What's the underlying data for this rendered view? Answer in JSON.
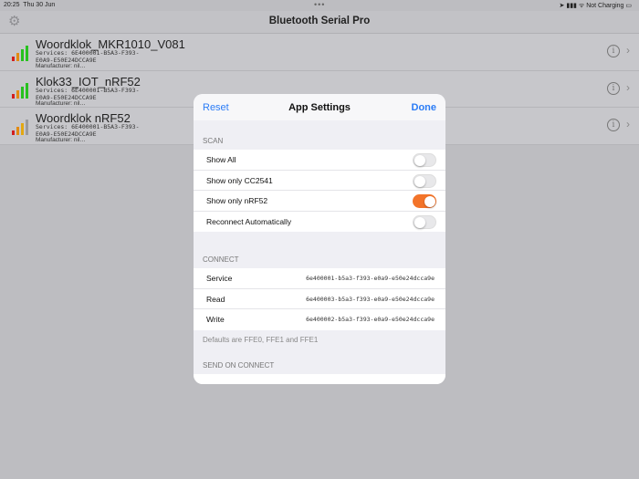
{
  "status": {
    "time": "20:25",
    "date": "Thu 30 Jun",
    "dots": "•••",
    "right": "Not Charging"
  },
  "nav": {
    "title": "Bluetooth Serial Pro",
    "gear_icon": "gear-icon"
  },
  "devices": [
    {
      "name": "Woordklok_MKR1010_V081",
      "services": "Services: 6E400001-B5A3-F393-E0A9-E50E24DCCA9E",
      "manufacturer": "Manufacturer: nil…",
      "signal": 4
    },
    {
      "name": "Klok33_IOT_nRF52",
      "services": "Services: 6E400001-B5A3-F393-E0A9-E50E24DCCA9E",
      "manufacturer": "Manufacturer: nil…",
      "signal": 4
    },
    {
      "name": "Woordklok nRF52",
      "services": "Services: 6E400001-B5A3-F393-E0A9-E50E24DCCA9E",
      "manufacturer": "Manufacturer: nil…",
      "signal": 3
    }
  ],
  "modal": {
    "reset": "Reset",
    "title": "App Settings",
    "done": "Done",
    "scan_header": "SCAN",
    "scan": [
      {
        "label": "Show All",
        "on": false
      },
      {
        "label": "Show only CC2541",
        "on": false
      },
      {
        "label": "Show only nRF52",
        "on": true
      },
      {
        "label": "Reconnect Automatically",
        "on": false
      }
    ],
    "connect_header": "CONNECT",
    "connect": [
      {
        "label": "Service",
        "value": "6e400001-b5a3-f393-e0a9-e50e24dcca9e"
      },
      {
        "label": "Read",
        "value": "6e400003-b5a3-f393-e0a9-e50e24dcca9e"
      },
      {
        "label": "Write",
        "value": "6e400002-b5a3-f393-e0a9-e50e24dcca9e"
      }
    ],
    "connect_footer": "Defaults are FFE0, FFE1 and FFE1",
    "send_header": "SEND ON CONNECT"
  },
  "colors": {
    "accent": "#2b7cf6",
    "toggle_on": "#f3742a"
  }
}
